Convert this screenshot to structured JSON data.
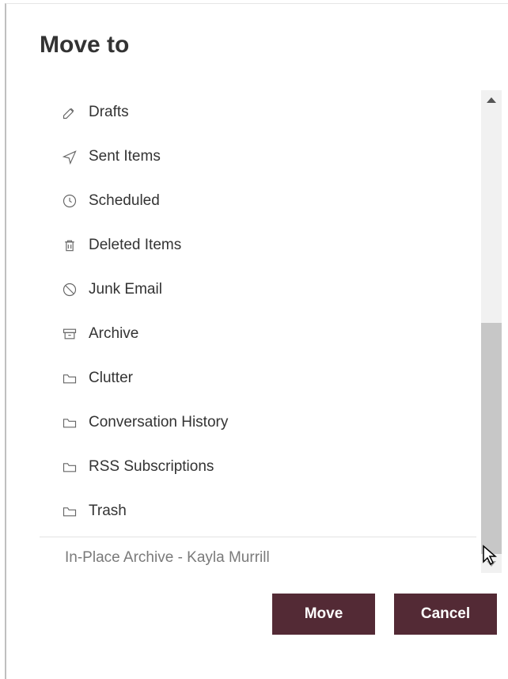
{
  "dialog": {
    "title": "Move to",
    "folders": [
      {
        "icon": "pencil-icon",
        "label": "Drafts"
      },
      {
        "icon": "send-icon",
        "label": "Sent Items"
      },
      {
        "icon": "clock-icon",
        "label": "Scheduled"
      },
      {
        "icon": "trash-icon",
        "label": "Deleted Items"
      },
      {
        "icon": "block-icon",
        "label": "Junk Email"
      },
      {
        "icon": "archive-icon",
        "label": "Archive"
      },
      {
        "icon": "folder-icon",
        "label": "Clutter"
      },
      {
        "icon": "folder-icon",
        "label": "Conversation History"
      },
      {
        "icon": "folder-icon",
        "label": "RSS Subscriptions"
      },
      {
        "icon": "folder-icon",
        "label": "Trash"
      }
    ],
    "section": "In-Place Archive - Kayla Murrill",
    "buttons": {
      "move": "Move",
      "cancel": "Cancel"
    }
  }
}
